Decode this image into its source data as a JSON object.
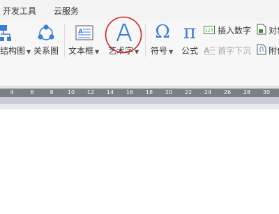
{
  "tabs": [
    {
      "label": "开发工具"
    },
    {
      "label": "云服务"
    }
  ],
  "ribbon": {
    "structure_chart": "结构图",
    "relation_chart": "关系图",
    "textbox": "文本框",
    "wordart": "艺术字",
    "symbol": "符号",
    "formula": "公式",
    "insert_number": "插入数字",
    "drop_cap": "首字下沉",
    "object": "对象",
    "attachment": "附件"
  },
  "ruler": {
    "ticks": [
      "4",
      "6",
      "8",
      "10",
      "12",
      "14",
      "16",
      "18",
      "20",
      "22",
      "24",
      "26",
      "28",
      "30"
    ]
  },
  "colors": {
    "accent": "#3d7dd6",
    "annotation_circle": "#d21f1f",
    "ruler": "#7b7f88"
  }
}
